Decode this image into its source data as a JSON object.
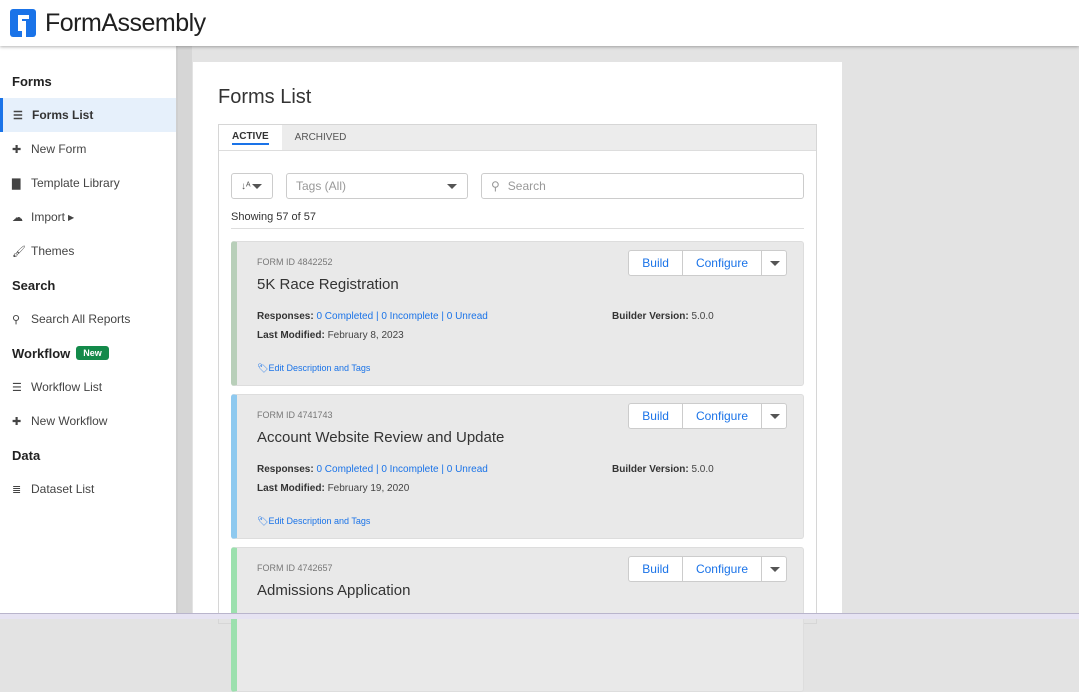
{
  "app": {
    "name": "FormAssembly"
  },
  "sidebar": {
    "sections": [
      {
        "label": "Forms",
        "items": [
          {
            "label": "Forms List",
            "icon": "list-icon"
          },
          {
            "label": "New Form",
            "icon": "plus-icon"
          },
          {
            "label": "Template Library",
            "icon": "file-icon"
          },
          {
            "label": "Import",
            "icon": "cloud-upload-icon"
          },
          {
            "label": "Themes",
            "icon": "brush-icon"
          }
        ]
      },
      {
        "label": "Search",
        "items": [
          {
            "label": "Search All Reports",
            "icon": "search-icon"
          }
        ]
      },
      {
        "label": "Workflow",
        "badge": "New",
        "items": [
          {
            "label": "Workflow List",
            "icon": "list-ol-icon"
          },
          {
            "label": "New Workflow",
            "icon": "plus-icon"
          }
        ]
      },
      {
        "label": "Data",
        "items": [
          {
            "label": "Dataset List",
            "icon": "database-icon"
          }
        ]
      }
    ]
  },
  "main": {
    "title": "Forms List",
    "tabs": [
      {
        "label": "ACTIVE",
        "active": true
      },
      {
        "label": "ARCHIVED"
      }
    ],
    "tags_select": "Tags (All)",
    "search_placeholder": "Search",
    "showing": "Showing 57 of 57",
    "labels": {
      "responses": "Responses:",
      "last_modified": "Last Modified:",
      "builder_version": "Builder Version:",
      "edit": "Edit Description and Tags",
      "build": "Build",
      "configure": "Configure"
    },
    "forms": [
      {
        "form_id": "FORM ID 4842252",
        "name": "5K Race Registration",
        "responses": "0 Completed | 0 Incomplete | 0 Unread",
        "last_modified": "February 8, 2023",
        "builder_version": "5.0.0",
        "color": "#b8cfb9"
      },
      {
        "form_id": "FORM ID 4741743",
        "name": "Account Website Review and Update",
        "responses": "0 Completed | 0 Incomplete | 0 Unread",
        "last_modified": "February 19, 2020",
        "builder_version": "5.0.0",
        "color": "#8ec9ef"
      },
      {
        "form_id": "FORM ID 4742657",
        "name": "Admissions Application",
        "color": "#9ce0ae"
      }
    ]
  }
}
